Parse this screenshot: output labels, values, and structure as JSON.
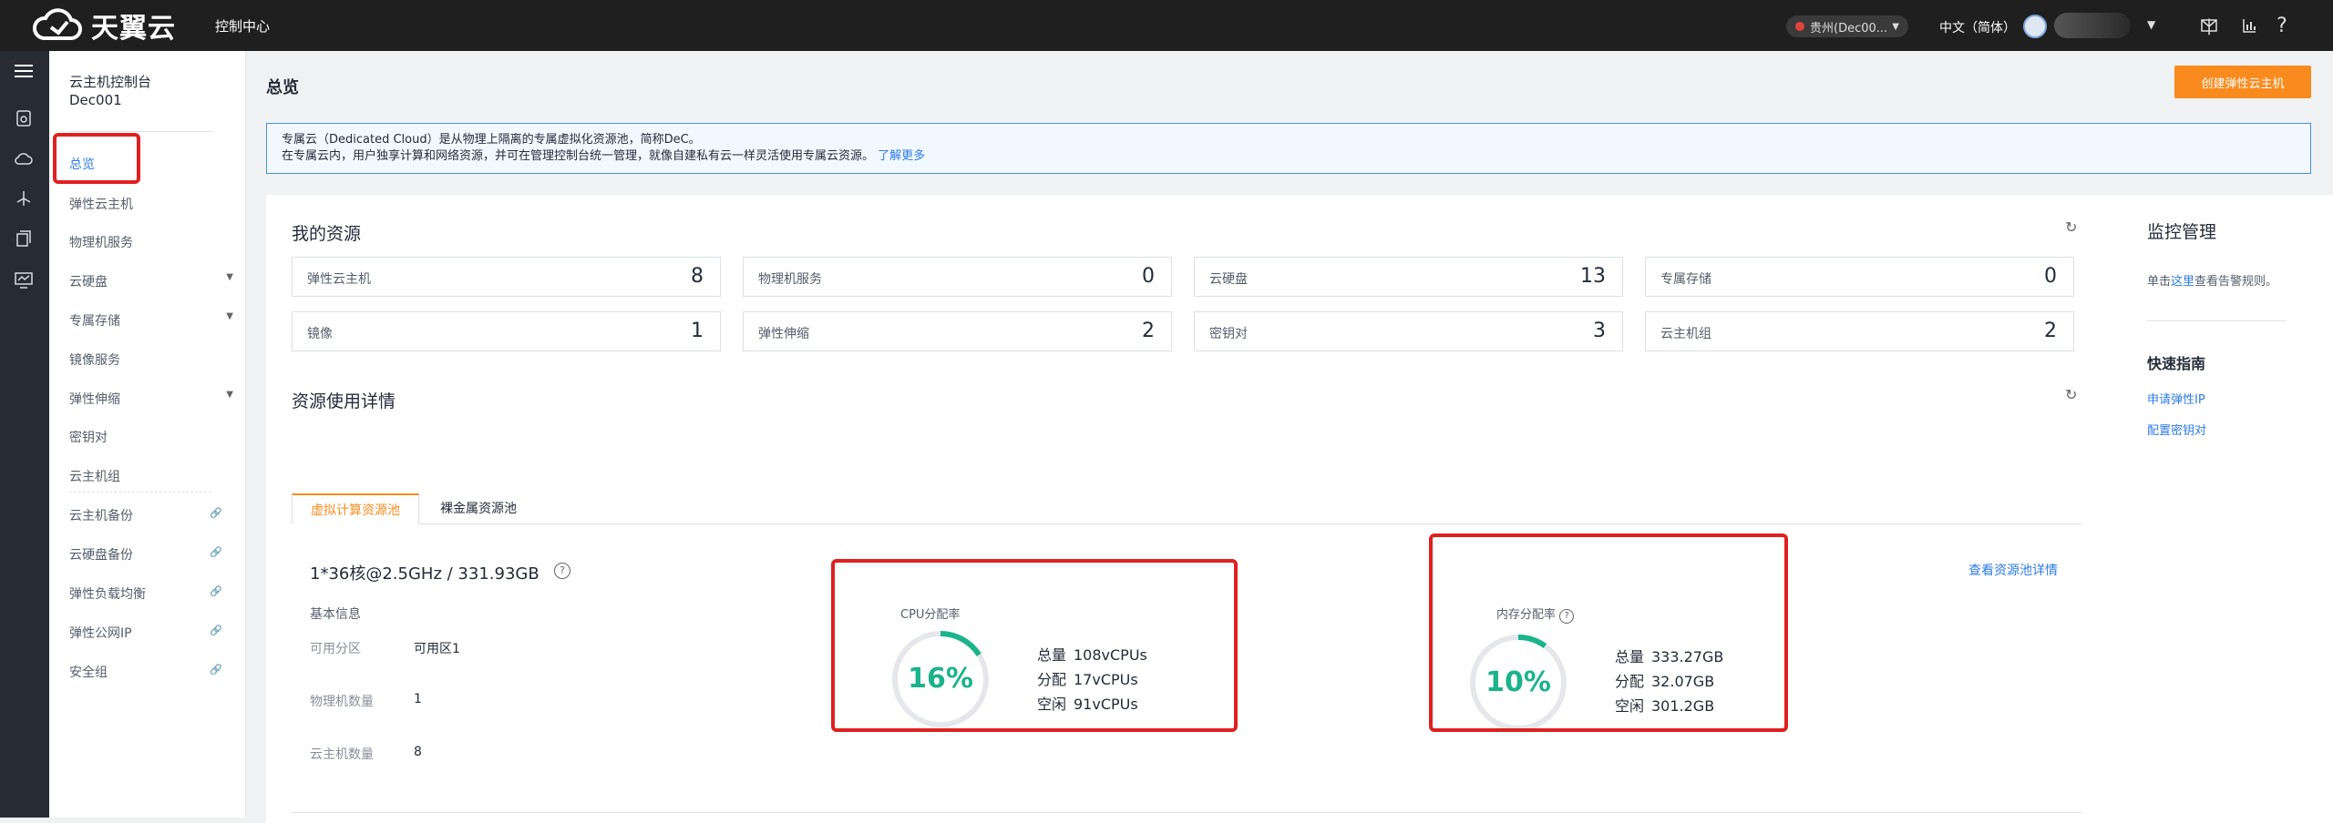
{
  "topbar": {
    "brand": "天翼云",
    "console": "控制中心",
    "region": "贵州(Dec00...",
    "language": "中文（简体）"
  },
  "sidebar": {
    "title_line1": "云主机控制台",
    "title_line2": "Dec001",
    "items": [
      {
        "label": "总览"
      },
      {
        "label": "弹性云主机"
      },
      {
        "label": "物理机服务"
      },
      {
        "label": "云硬盘"
      },
      {
        "label": "专属存储"
      },
      {
        "label": "镜像服务"
      },
      {
        "label": "弹性伸缩"
      },
      {
        "label": "密钥对"
      },
      {
        "label": "云主机组"
      },
      {
        "label": "云主机备份"
      },
      {
        "label": "云硬盘备份"
      },
      {
        "label": "弹性负载均衡"
      },
      {
        "label": "弹性公网IP"
      },
      {
        "label": "安全组"
      }
    ]
  },
  "main": {
    "page_title": "总览",
    "create_button": "创建弹性云主机",
    "notice_line1": "专属云（Dedicated Cloud）是从物理上隔离的专属虚拟化资源池，简称DeC。",
    "notice_line2": "在专属云内，用户独享计算和网络资源，并可在管理控制台统一管理，就像自建私有云一样灵活使用专属云资源。",
    "notice_link": "了解更多",
    "my_resources_title": "我的资源",
    "resources": [
      {
        "label": "弹性云主机",
        "value": "8"
      },
      {
        "label": "物理机服务",
        "value": "0"
      },
      {
        "label": "云硬盘",
        "value": "13"
      },
      {
        "label": "专属存储",
        "value": "0"
      },
      {
        "label": "镜像",
        "value": "1"
      },
      {
        "label": "弹性伸缩",
        "value": "2"
      },
      {
        "label": "密钥对",
        "value": "3"
      },
      {
        "label": "云主机组",
        "value": "2"
      }
    ],
    "usage_title": "资源使用详情",
    "tabs": [
      "虚拟计算资源池",
      "裸金属资源池"
    ],
    "pool_spec": "1*36核@2.5GHz / 331.93GB",
    "basic_info": "基本信息",
    "info": [
      {
        "key": "可用分区",
        "value": "可用区1"
      },
      {
        "key": "物理机数量",
        "value": "1"
      },
      {
        "key": "云主机数量",
        "value": "8"
      }
    ],
    "pool_detail_link": "查看资源池详情",
    "cpu": {
      "label": "CPU分配率",
      "percent": "16%",
      "fraction": 0.16,
      "total_k": "总量",
      "total_v": "108vCPUs",
      "alloc_k": "分配",
      "alloc_v": "17vCPUs",
      "free_k": "空闲",
      "free_v": "91vCPUs"
    },
    "mem": {
      "label": "内存分配率",
      "percent": "10%",
      "fraction": 0.1,
      "total_k": "总量",
      "total_v": "333.27GB",
      "alloc_k": "分配",
      "alloc_v": "32.07GB",
      "free_k": "空闲",
      "free_v": "301.2GB"
    }
  },
  "monitor": {
    "title": "监控管理",
    "text_pre": "单击",
    "text_link": "这里",
    "text_post": "查看告警规则。",
    "guide_title": "快速指南",
    "guide_links": [
      "申请弹性IP",
      "配置密钥对"
    ]
  },
  "colors": {
    "accent": "#f98b1e",
    "gauge": "#1bb38a",
    "link": "#2c7be5"
  }
}
